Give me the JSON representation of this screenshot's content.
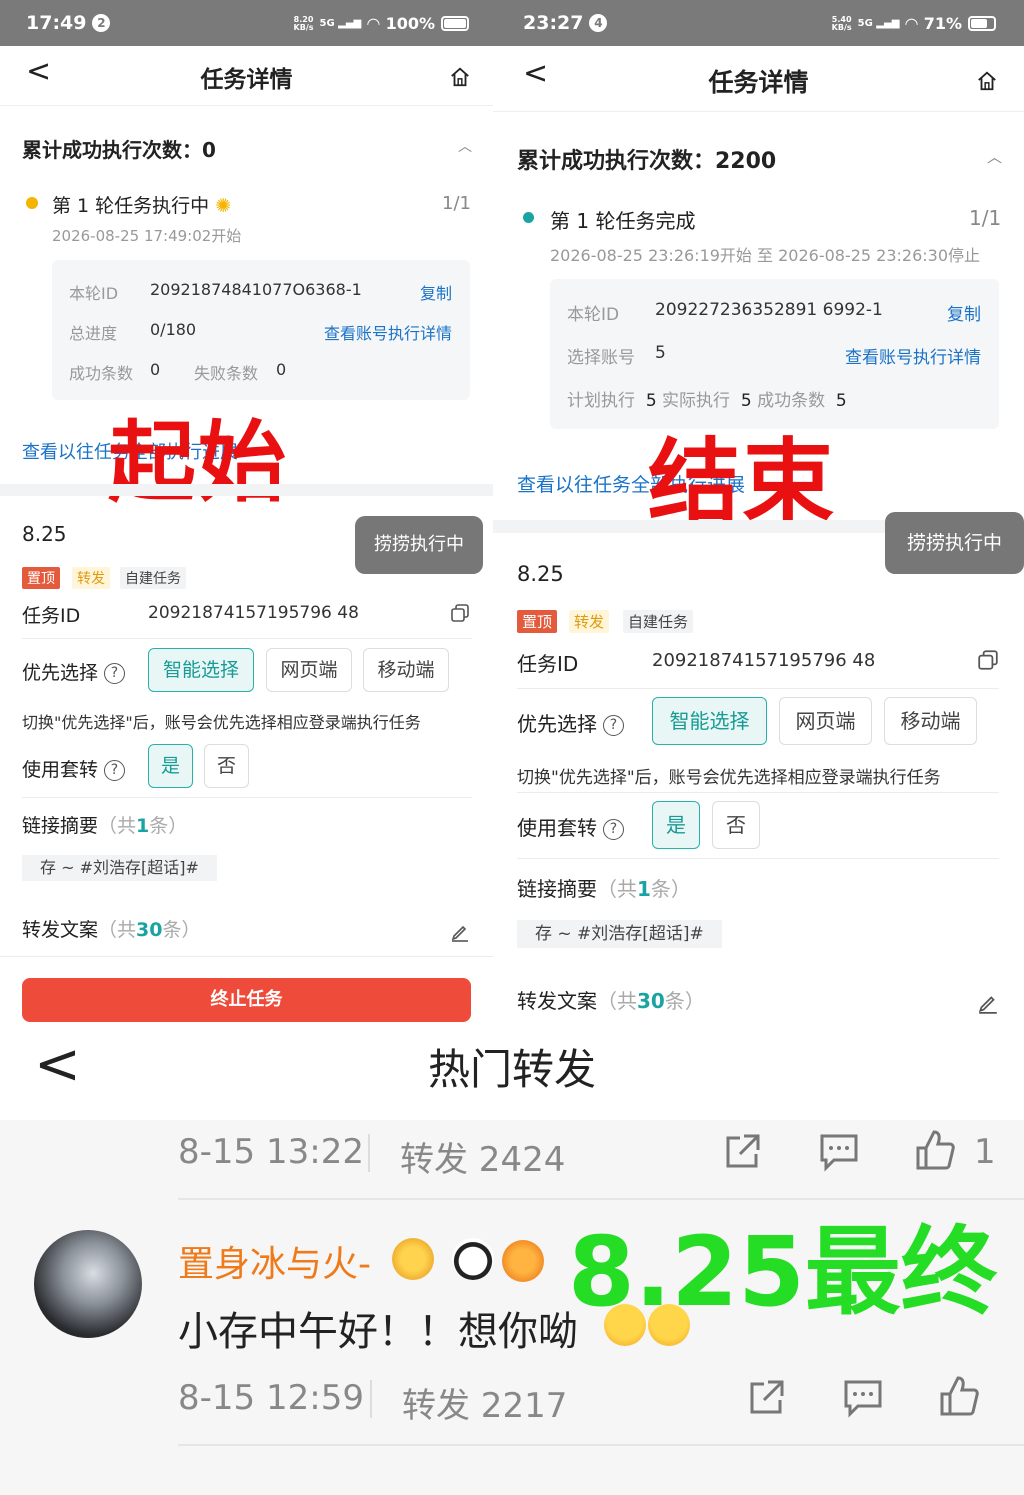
{
  "left": {
    "status": {
      "time": "17:49",
      "badge": "2",
      "net": "8.20\nKB/s",
      "sig": "5G",
      "battery": "100%",
      "battery_level": 1.0
    },
    "nav": {
      "title": "任务详情",
      "back": "<"
    },
    "summary": {
      "label": "累计成功执行次数：0"
    },
    "round": {
      "title": "第 1 轮任务执行中",
      "count": "1/1",
      "time": "2026-08-25 17:49:02开始"
    },
    "info": {
      "id_label": "本轮ID",
      "id_value": "20921874841077O6368-1",
      "copy": "复制",
      "progress_label": "总进度",
      "progress_value": "0/180",
      "detail_link": "查看账号执行详情",
      "success_label": "成功条数",
      "success_value": "0",
      "fail_label": "失败条数",
      "fail_value": "0"
    },
    "history_link": "查看以往任务全部执行进展",
    "overlay": "起始",
    "task": {
      "name": "8.25",
      "float_btn": "捞捞执行中",
      "tags": [
        "置顶",
        "转发",
        "自建任务"
      ],
      "id_label": "任务ID",
      "id_value": "20921874157195796 48",
      "priority_label": "优先选择",
      "priority_opts": [
        "智能选择",
        "网页端",
        "移动端"
      ],
      "hint": "切换\"优先选择\"后，账号会优先选择相应登录端执行任务",
      "taozhuan_label": "使用套转",
      "taozhuan_opts": [
        "是",
        "否"
      ],
      "links_label": "链接摘要",
      "links_pre": "（共",
      "links_count": "1",
      "links_post": "条）",
      "chip": "存 ~ #刘浩存[超话]#",
      "copy_label": "转发文案",
      "copy_pre": "（共",
      "copy_count": "30",
      "copy_post": "条）",
      "stop": "终止任务"
    }
  },
  "right": {
    "status": {
      "time": "23:27",
      "badge": "4",
      "net": "5.40\nKB/s",
      "sig": "5G",
      "battery": "71%",
      "battery_level": 0.71
    },
    "nav": {
      "title": "任务详情",
      "back": "<"
    },
    "summary": {
      "label": "累计成功执行次数：2200"
    },
    "round": {
      "title": "第 1 轮任务完成",
      "count": "1/1",
      "time": "2026-08-25 23:26:19开始 至 2026-08-25 23:26:30停止"
    },
    "info": {
      "id_label": "本轮ID",
      "id_value": "209227236352891 6992-1",
      "copy": "复制",
      "acct_label": "选择账号",
      "acct_value": "5",
      "detail_link": "查看账号执行详情",
      "plan_label": "计划执行",
      "plan_value": "5",
      "actual_label": "实际执行",
      "actual_value": "5",
      "success_label": "成功条数",
      "success_value": "5"
    },
    "history_link": "查看以往任务全部执行进展",
    "overlay": "结束",
    "task": {
      "name": "8.25",
      "float_btn": "捞捞执行中",
      "tags": [
        "置顶",
        "转发",
        "自建任务"
      ],
      "id_label": "任务ID",
      "id_value": "20921874157195796 48",
      "priority_label": "优先选择",
      "priority_opts": [
        "智能选择",
        "网页端",
        "移动端"
      ],
      "hint": "切换\"优先选择\"后，账号会优先选择相应登录端执行任务",
      "taozhuan_label": "使用套转",
      "taozhuan_opts": [
        "是",
        "否"
      ],
      "links_label": "链接摘要",
      "links_pre": "（共",
      "links_count": "1",
      "links_post": "条）",
      "chip": "存 ~ #刘浩存[超话]#",
      "copy_label": "转发文案",
      "copy_pre": "（共",
      "copy_count": "30",
      "copy_post": "条）"
    }
  },
  "bottom": {
    "title": "热门转发",
    "back": "<",
    "row1": {
      "time": "8-15 13:22",
      "reposts": "转发 2424",
      "likes": "1"
    },
    "post": {
      "user": "置身冰与火-",
      "text": "小存中午好！！想你呦"
    },
    "row2": {
      "time": "8-15 12:59",
      "reposts": "转发 2217"
    },
    "overlay": "8.25最终"
  }
}
